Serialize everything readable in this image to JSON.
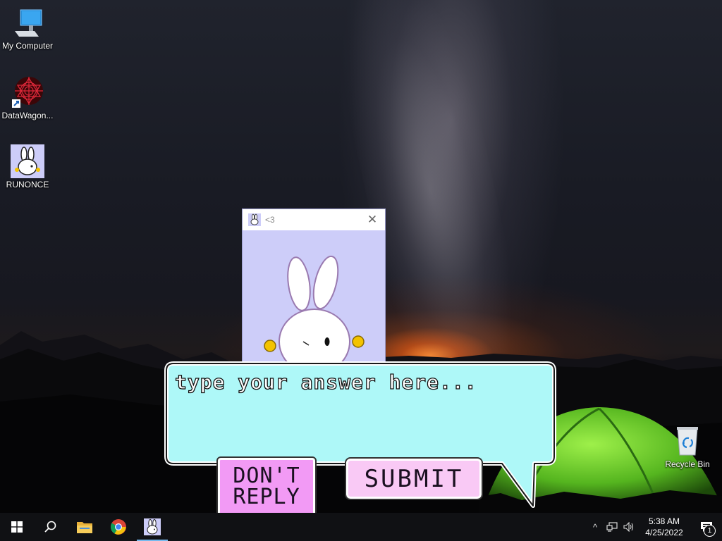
{
  "desktop": {
    "icons": [
      {
        "label": "My Computer",
        "icon": "monitor-icon"
      },
      {
        "label": "DataWagon...",
        "icon": "datawagon-icon"
      },
      {
        "label": "RUNONCE",
        "icon": "bunny-icon"
      },
      {
        "label": "Recycle Bin",
        "icon": "recycle-bin-icon"
      }
    ]
  },
  "dialog": {
    "title": "<3",
    "close_glyph": "✕",
    "answer_placeholder": "type your answer here...",
    "dont_reply_label": "DON'T REPLY",
    "submit_label": "SUBMIT",
    "bubble_color": "#aef8f8",
    "window_bg": "#cdcdf9"
  },
  "taskbar": {
    "start_icon": "windows-logo-icon",
    "search_icon": "search-icon",
    "pinned": [
      {
        "name": "File Explorer",
        "icon": "folder-icon"
      },
      {
        "name": "Google Chrome",
        "icon": "chrome-icon"
      },
      {
        "name": "RUNONCE",
        "icon": "bunny-icon",
        "active": true
      }
    ],
    "tray": {
      "chevron": "^",
      "time": "5:38 AM",
      "date": "4/25/2022",
      "notification_count": "1"
    }
  }
}
